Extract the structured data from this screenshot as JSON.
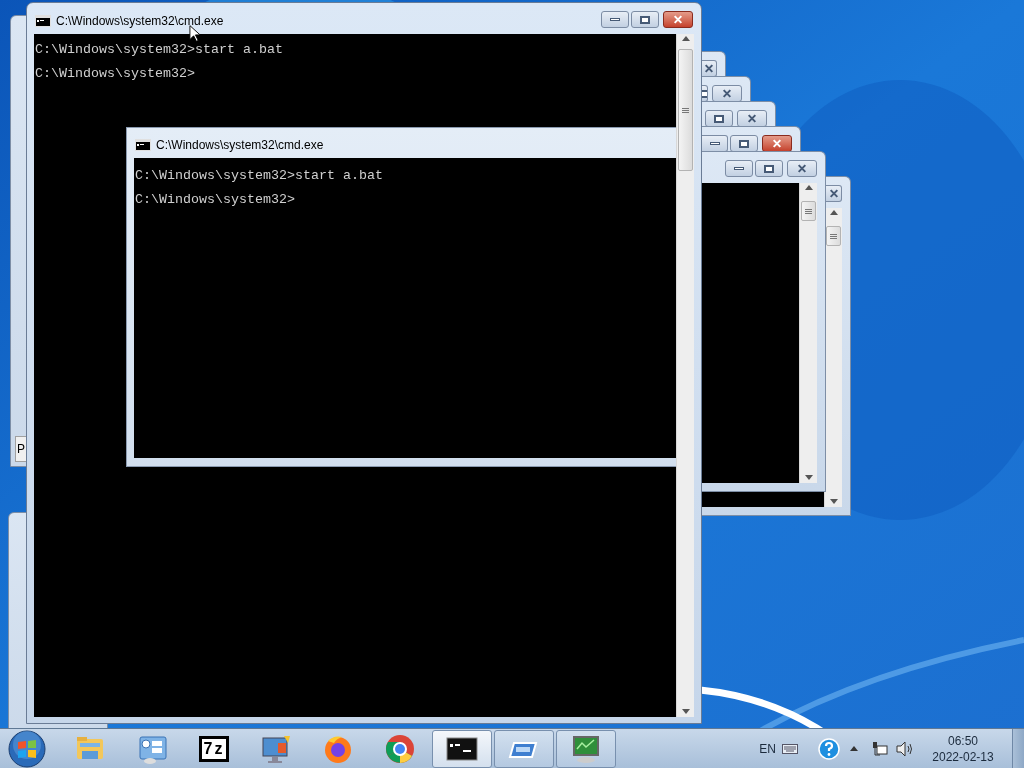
{
  "background_windows": [
    {
      "close_highlighted": false
    },
    {
      "close_highlighted": false
    },
    {
      "close_highlighted": false
    },
    {
      "close_highlighted": true
    },
    {
      "close_highlighted": false
    },
    {
      "close_highlighted": false
    }
  ],
  "left_window": {
    "text": "P"
  },
  "main_window": {
    "title": "C:\\Windows\\system32\\cmd.exe",
    "lines": [
      "C:\\Windows\\system32>start a.bat",
      "C:\\Windows\\system32>"
    ]
  },
  "inner_window": {
    "title": "C:\\Windows\\system32\\cmd.exe",
    "lines": [
      "C:\\Windows\\system32>start a.bat",
      "C:\\Windows\\system32>"
    ]
  },
  "taskbar": {
    "items": [
      {
        "kind": "folder",
        "running": false,
        "selected": false
      },
      {
        "kind": "control-panel",
        "running": false,
        "selected": false
      },
      {
        "kind": "sevenzip",
        "label": "7z",
        "running": false,
        "selected": false
      },
      {
        "kind": "computer",
        "running": false,
        "selected": false
      },
      {
        "kind": "firefox",
        "running": false,
        "selected": false
      },
      {
        "kind": "chrome",
        "running": false,
        "selected": false
      },
      {
        "kind": "console",
        "running": true,
        "selected": true
      },
      {
        "kind": "drive",
        "running": true,
        "selected": false
      },
      {
        "kind": "monitor",
        "running": true,
        "selected": false
      }
    ],
    "tray": {
      "language": "EN",
      "time": "06:50",
      "date": "2022-02-13"
    }
  }
}
